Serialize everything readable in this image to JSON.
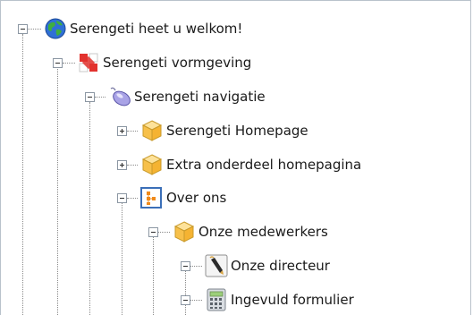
{
  "tree": {
    "items": [
      {
        "label": "Serengeti heet u welkom!",
        "icon": "globe-icon",
        "expander": "minus"
      },
      {
        "label": "Serengeti vormgeving",
        "icon": "design-icon",
        "expander": "minus"
      },
      {
        "label": "Serengeti navigatie",
        "icon": "mouse-icon",
        "expander": "minus"
      },
      {
        "label": "Serengeti Homepage",
        "icon": "page-cube-icon",
        "expander": "plus"
      },
      {
        "label": "Extra onderdeel homepagina",
        "icon": "page-cube-icon",
        "expander": "plus"
      },
      {
        "label": "Over ons",
        "icon": "sitemap-icon",
        "expander": "minus"
      },
      {
        "label": "Onze medewerkers",
        "icon": "page-cube-icon",
        "expander": "minus"
      },
      {
        "label": "Onze directeur",
        "icon": "pen-icon",
        "expander": "minus"
      },
      {
        "label": "Ingevuld formulier",
        "icon": "calculator-icon",
        "expander": "minus"
      }
    ]
  },
  "colors": {
    "border": "#b9c2cb",
    "connector": "#8a8a8a",
    "cube": "#f7c04a",
    "sitemap_border": "#3b6fb8",
    "sitemap_fill": "#f08a1a"
  }
}
